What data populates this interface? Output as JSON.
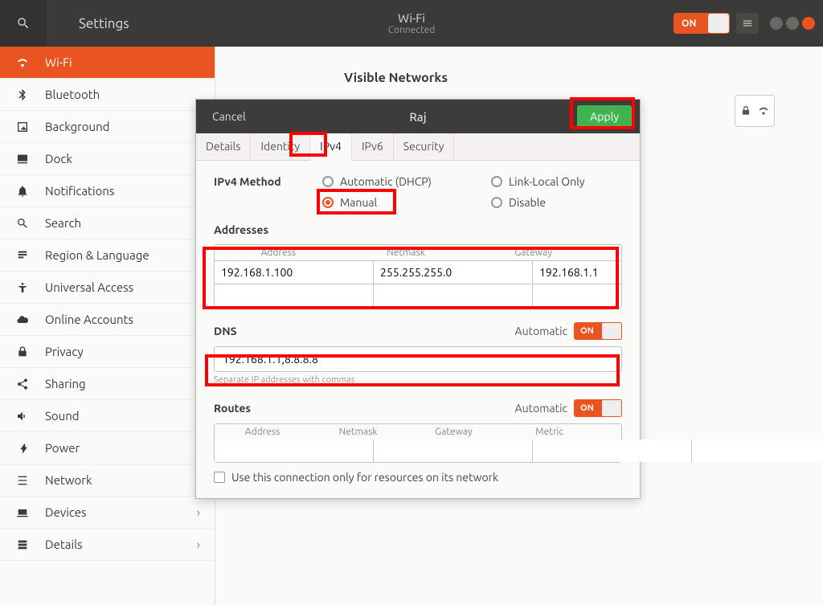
{
  "header": {
    "settings_label": "Settings",
    "title": "Wi-Fi",
    "subtitle": "Connected",
    "toggle_label": "ON"
  },
  "sidebar": {
    "items": [
      {
        "label": "Wi-Fi",
        "icon": "wifi"
      },
      {
        "label": "Bluetooth",
        "icon": "bluetooth"
      },
      {
        "label": "Background",
        "icon": "background"
      },
      {
        "label": "Dock",
        "icon": "dock"
      },
      {
        "label": "Notifications",
        "icon": "bell"
      },
      {
        "label": "Search",
        "icon": "search"
      },
      {
        "label": "Region & Language",
        "icon": "region"
      },
      {
        "label": "Universal Access",
        "icon": "access"
      },
      {
        "label": "Online Accounts",
        "icon": "cloud"
      },
      {
        "label": "Privacy",
        "icon": "privacy"
      },
      {
        "label": "Sharing",
        "icon": "share"
      },
      {
        "label": "Sound",
        "icon": "sound"
      },
      {
        "label": "Power",
        "icon": "power"
      },
      {
        "label": "Network",
        "icon": "network"
      },
      {
        "label": "Devices",
        "icon": "devices",
        "chevron": true
      },
      {
        "label": "Details",
        "icon": "details",
        "chevron": true
      }
    ]
  },
  "content": {
    "visible_networks": "Visible Networks"
  },
  "dialog": {
    "cancel": "Cancel",
    "title": "Raj",
    "apply": "Apply",
    "tabs": {
      "details": "Details",
      "identity": "Identity",
      "ipv4": "IPv4",
      "ipv6": "IPv6",
      "security": "Security"
    },
    "ipv4": {
      "method_label": "IPv4 Method",
      "auto_dhcp": "Automatic (DHCP)",
      "link_local": "Link-Local Only",
      "manual": "Manual",
      "disable": "Disable",
      "addresses_label": "Addresses",
      "col_address": "Address",
      "col_netmask": "Netmask",
      "col_gateway": "Gateway",
      "col_metric": "Metric",
      "rows": [
        {
          "address": "192.168.1.100",
          "netmask": "255.255.255.0",
          "gateway": "192.168.1.1"
        }
      ],
      "dns_label": "DNS",
      "automatic_label": "Automatic",
      "dns_toggle": "ON",
      "dns_value": "192.168.1.1,8.8.8.8",
      "dns_hint": "Separate IP addresses with commas",
      "routes_label": "Routes",
      "routes_toggle": "ON",
      "check_label": "Use this connection only for resources on its network"
    }
  }
}
